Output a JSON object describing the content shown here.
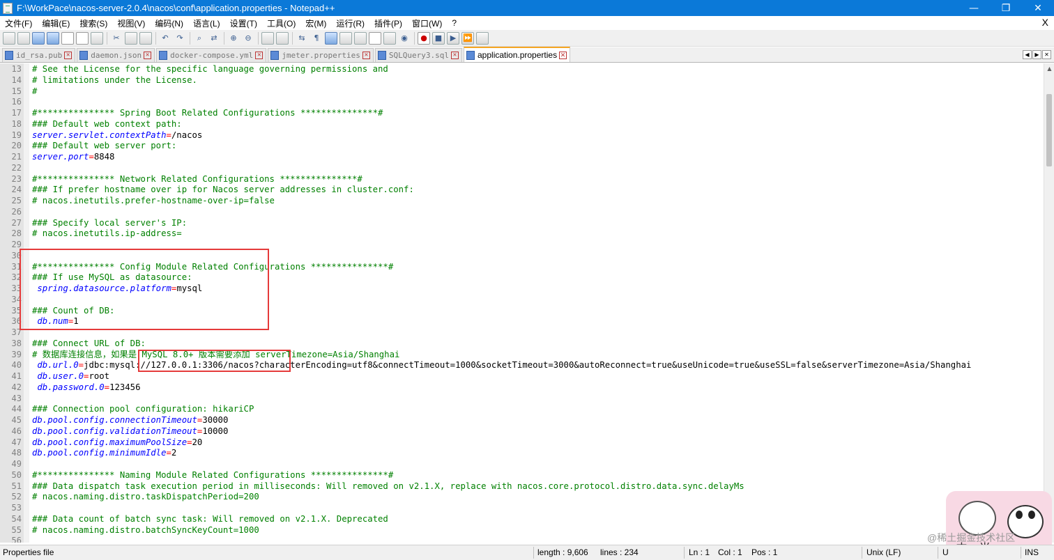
{
  "window": {
    "title": "F:\\WorkPace\\nacos-server-2.0.4\\nacos\\conf\\application.properties - Notepad++",
    "controls": [
      "—",
      "❐",
      "✕"
    ]
  },
  "menu": {
    "items": [
      "文件(F)",
      "编辑(E)",
      "搜索(S)",
      "视图(V)",
      "编码(N)",
      "语言(L)",
      "设置(T)",
      "工具(O)",
      "宏(M)",
      "运行(R)",
      "插件(P)",
      "窗口(W)",
      "?"
    ],
    "close_label": "X"
  },
  "toolbar": {
    "icons": [
      "new-file-icon",
      "open-file-icon",
      "save-icon",
      "save-all-icon",
      "close-icon",
      "close-all-icon",
      "print-icon",
      "cut-icon",
      "copy-icon",
      "paste-icon",
      "undo-icon",
      "redo-icon",
      "find-icon",
      "replace-icon",
      "zoom-in-icon",
      "zoom-out-icon",
      "sync-vertical-icon",
      "sync-horizontal-icon",
      "word-wrap-icon",
      "show-all-chars-icon",
      "indent-guide-icon",
      "user-lang-icon",
      "doc-map-icon",
      "function-list-icon",
      "folder-workspace-icon",
      "monitor-icon",
      "record-macro-icon",
      "stop-macro-icon",
      "play-macro-icon",
      "run-macro-multiple-icon",
      "save-macro-icon"
    ]
  },
  "tabs": [
    {
      "label": "id_rsa.pub",
      "active": false
    },
    {
      "label": "daemon.json",
      "active": false
    },
    {
      "label": "docker-compose.yml",
      "active": false
    },
    {
      "label": "jmeter.properties",
      "active": false
    },
    {
      "label": "SQLQuery3.sql",
      "active": false
    },
    {
      "label": "application.properties",
      "active": true
    }
  ],
  "tab_scroll": [
    "◀",
    "▶",
    "✕"
  ],
  "editor": {
    "lines": [
      {
        "n": "13",
        "parts": [
          {
            "t": "comment",
            "s": "# See the License for the specific language governing permissions and"
          }
        ]
      },
      {
        "n": "14",
        "parts": [
          {
            "t": "comment",
            "s": "# limitations under the License."
          }
        ]
      },
      {
        "n": "15",
        "parts": [
          {
            "t": "comment",
            "s": "#"
          }
        ]
      },
      {
        "n": "16",
        "parts": []
      },
      {
        "n": "17",
        "parts": [
          {
            "t": "comment",
            "s": "#*************** Spring Boot Related Configurations ***************#"
          }
        ]
      },
      {
        "n": "18",
        "parts": [
          {
            "t": "comment",
            "s": "### Default web context path:"
          }
        ]
      },
      {
        "n": "19",
        "parts": [
          {
            "t": "key",
            "s": "server.servlet.contextPath"
          },
          {
            "t": "eq",
            "s": "="
          },
          {
            "t": "val",
            "s": "/nacos"
          }
        ]
      },
      {
        "n": "20",
        "parts": [
          {
            "t": "comment",
            "s": "### Default web server port:"
          }
        ]
      },
      {
        "n": "21",
        "parts": [
          {
            "t": "key",
            "s": "server.port"
          },
          {
            "t": "eq",
            "s": "="
          },
          {
            "t": "val",
            "s": "8848"
          }
        ]
      },
      {
        "n": "22",
        "parts": []
      },
      {
        "n": "23",
        "parts": [
          {
            "t": "comment",
            "s": "#*************** Network Related Configurations ***************#"
          }
        ]
      },
      {
        "n": "24",
        "parts": [
          {
            "t": "comment",
            "s": "### If prefer hostname over ip for Nacos server addresses in cluster.conf:"
          }
        ]
      },
      {
        "n": "25",
        "parts": [
          {
            "t": "comment",
            "s": "# nacos.inetutils.prefer-hostname-over-ip=false"
          }
        ]
      },
      {
        "n": "26",
        "parts": []
      },
      {
        "n": "27",
        "parts": [
          {
            "t": "comment",
            "s": "### Specify local server's IP:"
          }
        ]
      },
      {
        "n": "28",
        "parts": [
          {
            "t": "comment",
            "s": "# nacos.inetutils.ip-address="
          }
        ]
      },
      {
        "n": "29",
        "parts": []
      },
      {
        "n": "30",
        "parts": []
      },
      {
        "n": "31",
        "parts": [
          {
            "t": "comment",
            "s": "#*************** Config Module Related Configurations ***************#"
          }
        ]
      },
      {
        "n": "32",
        "parts": [
          {
            "t": "comment",
            "s": "### If use MySQL as datasource:"
          }
        ]
      },
      {
        "n": "33",
        "parts": [
          {
            "t": "val",
            "s": " "
          },
          {
            "t": "key",
            "s": "spring.datasource.platform"
          },
          {
            "t": "eq",
            "s": "="
          },
          {
            "t": "val",
            "s": "mysql"
          }
        ]
      },
      {
        "n": "34",
        "parts": []
      },
      {
        "n": "35",
        "parts": [
          {
            "t": "comment",
            "s": "### Count of DB:"
          }
        ]
      },
      {
        "n": "36",
        "parts": [
          {
            "t": "val",
            "s": " "
          },
          {
            "t": "key",
            "s": "db.num"
          },
          {
            "t": "eq",
            "s": "="
          },
          {
            "t": "val",
            "s": "1"
          }
        ]
      },
      {
        "n": "37",
        "parts": []
      },
      {
        "n": "38",
        "parts": [
          {
            "t": "comment",
            "s": "### Connect URL of DB:"
          }
        ]
      },
      {
        "n": "39",
        "parts": [
          {
            "t": "comment",
            "s": "# 数据库连接信息，如果是 MySQL 8.0+ 版本需要添加 serverTimezone=Asia/Shanghai"
          }
        ]
      },
      {
        "n": "40",
        "parts": [
          {
            "t": "val",
            "s": " "
          },
          {
            "t": "key",
            "s": "db.url.0"
          },
          {
            "t": "eq",
            "s": "="
          },
          {
            "t": "val",
            "s": "jdbc:mysql://127.0.0.1:3306/nacos?characterEncoding=utf8&connectTimeout=1000&socketTimeout=3000&autoReconnect=true&useUnicode=true&useSSL=false&serverTimezone=Asia/Shanghai"
          }
        ]
      },
      {
        "n": "41",
        "parts": [
          {
            "t": "val",
            "s": " "
          },
          {
            "t": "key",
            "s": "db.user.0"
          },
          {
            "t": "eq",
            "s": "="
          },
          {
            "t": "val",
            "s": "root"
          }
        ]
      },
      {
        "n": "42",
        "parts": [
          {
            "t": "val",
            "s": " "
          },
          {
            "t": "key",
            "s": "db.password.0"
          },
          {
            "t": "eq",
            "s": "="
          },
          {
            "t": "val",
            "s": "123456"
          }
        ]
      },
      {
        "n": "43",
        "parts": []
      },
      {
        "n": "44",
        "parts": [
          {
            "t": "comment",
            "s": "### Connection pool configuration: hikariCP"
          }
        ]
      },
      {
        "n": "45",
        "parts": [
          {
            "t": "key",
            "s": "db.pool.config.connectionTimeout"
          },
          {
            "t": "eq",
            "s": "="
          },
          {
            "t": "val",
            "s": "30000"
          }
        ]
      },
      {
        "n": "46",
        "parts": [
          {
            "t": "key",
            "s": "db.pool.config.validationTimeout"
          },
          {
            "t": "eq",
            "s": "="
          },
          {
            "t": "val",
            "s": "10000"
          }
        ]
      },
      {
        "n": "47",
        "parts": [
          {
            "t": "key",
            "s": "db.pool.config.maximumPoolSize"
          },
          {
            "t": "eq",
            "s": "="
          },
          {
            "t": "val",
            "s": "20"
          }
        ]
      },
      {
        "n": "48",
        "parts": [
          {
            "t": "key",
            "s": "db.pool.config.minimumIdle"
          },
          {
            "t": "eq",
            "s": "="
          },
          {
            "t": "val",
            "s": "2"
          }
        ]
      },
      {
        "n": "49",
        "parts": []
      },
      {
        "n": "50",
        "parts": [
          {
            "t": "comment",
            "s": "#*************** Naming Module Related Configurations ***************#"
          }
        ]
      },
      {
        "n": "51",
        "parts": [
          {
            "t": "comment",
            "s": "### Data dispatch task execution period in milliseconds: Will removed on v2.1.X, replace with nacos.core.protocol.distro.data.sync.delayMs"
          }
        ]
      },
      {
        "n": "52",
        "parts": [
          {
            "t": "comment",
            "s": "# nacos.naming.distro.taskDispatchPeriod=200"
          }
        ]
      },
      {
        "n": "53",
        "parts": []
      },
      {
        "n": "54",
        "parts": [
          {
            "t": "comment",
            "s": "### Data count of batch sync task: Will removed on v2.1.X. Deprecated"
          }
        ]
      },
      {
        "n": "55",
        "parts": [
          {
            "t": "comment",
            "s": "# nacos.naming.distro.batchSyncKeyCount=1000"
          }
        ]
      },
      {
        "n": "56",
        "parts": []
      }
    ]
  },
  "watermark": {
    "text": "@稀土掘金技术社区",
    "badge": "中 · 半"
  },
  "statusbar": {
    "file_type": "Properties file",
    "length": "length : 9,606",
    "lines": "lines : 234",
    "ln": "Ln : 1",
    "col": "Col : 1",
    "pos": "Pos : 1",
    "eol": "Unix (LF)",
    "encoding": "U",
    "mode": "INS"
  },
  "colors": {
    "titlebar": "#0b79d8",
    "comment": "#008000",
    "key": "#0000ff",
    "equals": "#ff0000",
    "highlight_box": "#e53a3a",
    "active_tab_accent": "#f5a623"
  }
}
